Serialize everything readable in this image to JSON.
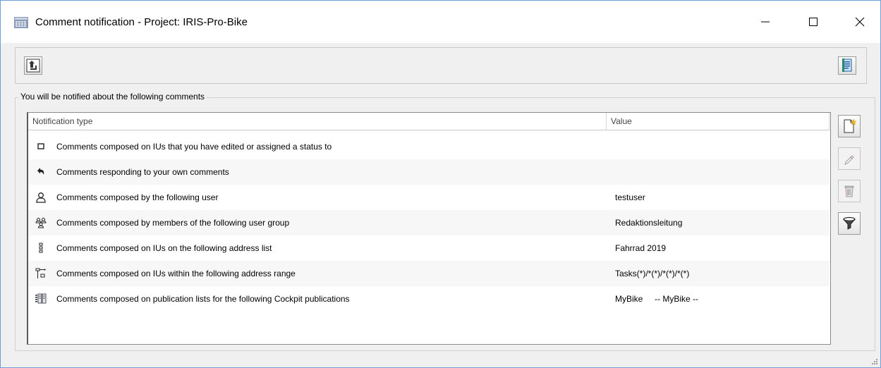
{
  "window": {
    "title": "Comment notification - Project: IRIS-Pro-Bike",
    "controls": [
      "minimize-icon",
      "maximize-icon",
      "close-icon"
    ]
  },
  "toolbar": {
    "left_icon": "up-level-icon",
    "right_icon": "notes-icon"
  },
  "group": {
    "legend": "You will be notified about the following comments"
  },
  "table": {
    "columns": [
      "Notification type",
      "Value"
    ],
    "rows": [
      {
        "icon": "square-bullet-icon",
        "type": "Comments composed on IUs that you have edited or assigned a status to",
        "value": ""
      },
      {
        "icon": "reply-arrow-icon",
        "type": "Comments responding to your own comments",
        "value": ""
      },
      {
        "icon": "user-icon",
        "type": "Comments composed by the following user",
        "value": "testuser"
      },
      {
        "icon": "user-group-icon",
        "type": "Comments composed by members of the following user group",
        "value": "Redaktionsleitung"
      },
      {
        "icon": "address-list-icon",
        "type": "Comments composed on IUs on the following address list",
        "value": "Fahrrad 2019"
      },
      {
        "icon": "address-range-icon",
        "type": "Comments composed on IUs within the following address range",
        "value": "Tasks(*)/*(*)/*(*)/*(*)"
      },
      {
        "icon": "publication-list-icon",
        "type": "Comments composed on publication lists for the following Cockpit publications",
        "value": "MyBike     -- MyBike --"
      }
    ]
  },
  "side_buttons": [
    {
      "icon": "new-document-icon",
      "enabled": true
    },
    {
      "icon": "edit-pencil-icon",
      "enabled": false
    },
    {
      "icon": "delete-trash-icon",
      "enabled": false
    },
    {
      "icon": "filter-funnel-icon",
      "enabled": true
    }
  ]
}
